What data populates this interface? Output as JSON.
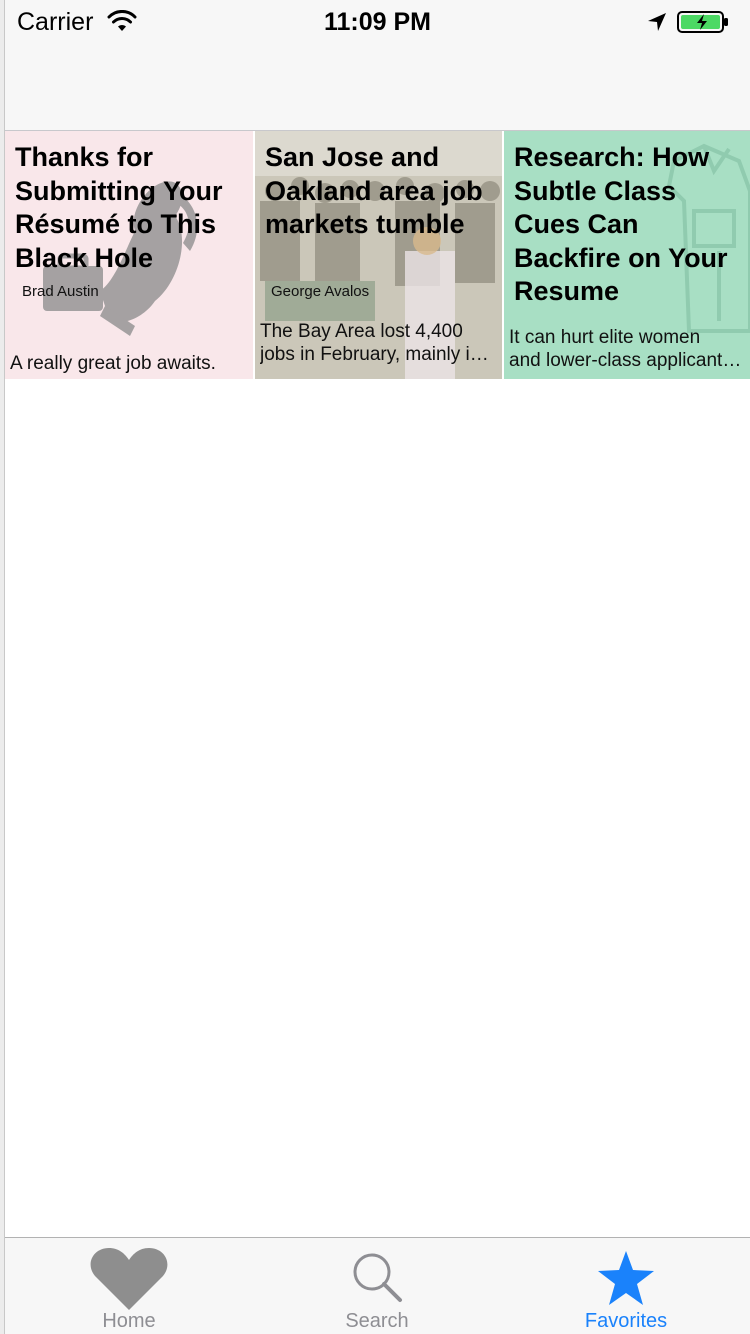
{
  "status_bar": {
    "carrier": "Carrier",
    "time": "11:09 PM"
  },
  "cards": [
    {
      "title": "Thanks for Submitting Your Résumé to This Black Hole",
      "author": "Brad Austin",
      "description": "A really great job awaits.",
      "background": "#f9e7ea"
    },
    {
      "title": "San Jose and Oakland area job markets tumble",
      "author": "George Avalos",
      "description_lines": [
        "The Bay Area lost 4,400",
        "jobs in February, mainly in the"
      ],
      "background": "#cbc7b9"
    },
    {
      "title": "Research: How Subtle Class Cues Can Backfire on Your Resume",
      "author": "",
      "description_lines": [
        "It can hurt elite women",
        "and lower-class applicants alike."
      ],
      "background": "#a8dfc4"
    }
  ],
  "tab_bar": {
    "home_label": "Home",
    "search_label": "Search",
    "favorites_label": "Favorites",
    "active_color": "#1a82fb",
    "inactive_color": "#8e8e93"
  }
}
